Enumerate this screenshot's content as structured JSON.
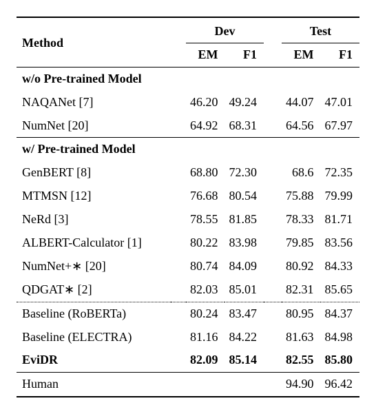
{
  "chart_data": {
    "type": "table",
    "title": "",
    "header": {
      "method": "Method",
      "dev": "Dev",
      "test": "Test",
      "em": "EM",
      "f1": "F1"
    },
    "sections": [
      {
        "label": "w/o Pre-trained Model",
        "rows": [
          {
            "method": "NAQANet [7]",
            "dev_em": "46.20",
            "dev_f1": "49.24",
            "test_em": "44.07",
            "test_f1": "47.01"
          },
          {
            "method": "NumNet [20]",
            "dev_em": "64.92",
            "dev_f1": "68.31",
            "test_em": "64.56",
            "test_f1": "67.97"
          }
        ]
      },
      {
        "label": "w/ Pre-trained Model",
        "rows": [
          {
            "method": "GenBERT [8]",
            "dev_em": "68.80",
            "dev_f1": "72.30",
            "test_em": "68.6",
            "test_f1": "72.35"
          },
          {
            "method": "MTMSN [12]",
            "dev_em": "76.68",
            "dev_f1": "80.54",
            "test_em": "75.88",
            "test_f1": "79.99"
          },
          {
            "method": "NeRd [3]",
            "dev_em": "78.55",
            "dev_f1": "81.85",
            "test_em": "78.33",
            "test_f1": "81.71"
          },
          {
            "method": "ALBERT-Calculator [1]",
            "dev_em": "80.22",
            "dev_f1": "83.98",
            "test_em": "79.85",
            "test_f1": "83.56"
          },
          {
            "method": "NumNet+∗ [20]",
            "dev_em": "80.74",
            "dev_f1": "84.09",
            "test_em": "80.92",
            "test_f1": "84.33"
          },
          {
            "method": "QDGAT∗ [2]",
            "dev_em": "82.03",
            "dev_f1": "85.01",
            "test_em": "82.31",
            "test_f1": "85.65"
          }
        ],
        "dotted_after": 6,
        "subrows": [
          {
            "method": "Baseline (RoBERTa)",
            "dev_em": "80.24",
            "dev_f1": "83.47",
            "test_em": "80.95",
            "test_f1": "84.37"
          },
          {
            "method": "Baseline (ELECTRA)",
            "dev_em": "81.16",
            "dev_f1": "84.22",
            "test_em": "81.63",
            "test_f1": "84.98"
          },
          {
            "method": "EviDR",
            "dev_em": "82.09",
            "dev_f1": "85.14",
            "test_em": "82.55",
            "test_f1": "85.80",
            "bold": true
          }
        ]
      }
    ],
    "footer": {
      "method": "Human",
      "dev_em": "",
      "dev_f1": "",
      "test_em": "94.90",
      "test_f1": "96.42"
    }
  }
}
